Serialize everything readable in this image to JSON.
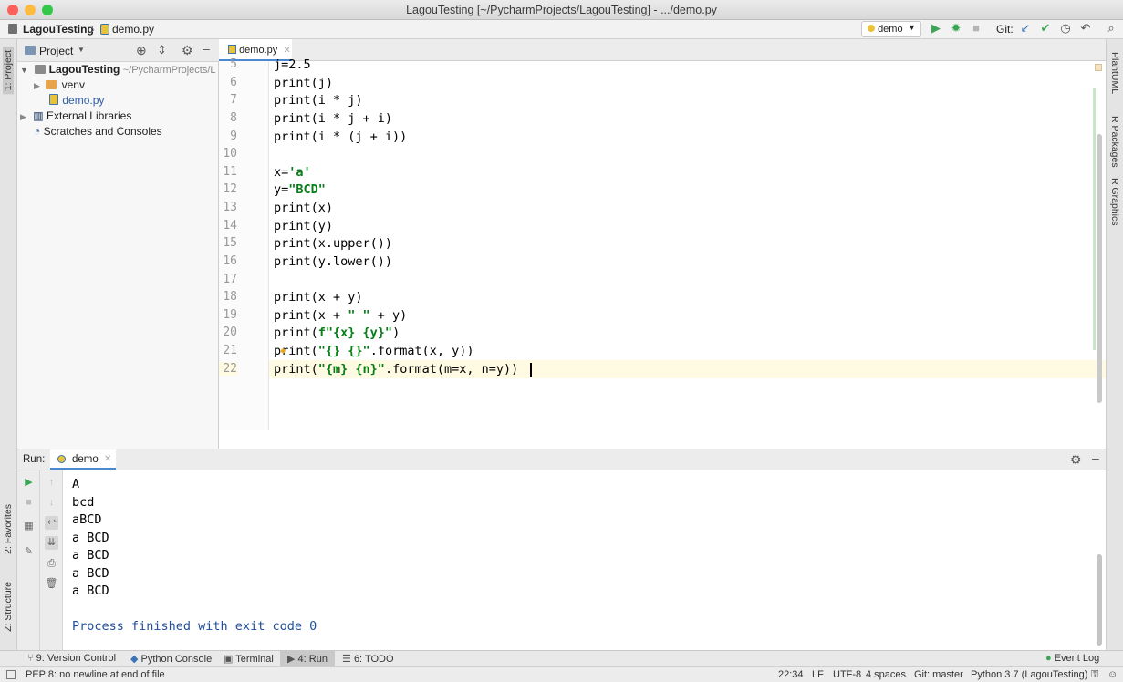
{
  "window": {
    "title": "LagouTesting [~/PycharmProjects/LagouTesting] - .../demo.py"
  },
  "navbar": {
    "project": "LagouTesting",
    "file": "demo.py",
    "run_config": "demo",
    "git_label": "Git:"
  },
  "project_panel": {
    "title": "Project",
    "root": {
      "name": "LagouTesting",
      "path": "~/PycharmProjects/L"
    },
    "items": [
      {
        "label": "venv",
        "icon": "folder-icon"
      },
      {
        "label": "demo.py",
        "icon": "python-file-icon"
      },
      {
        "label": "External Libraries",
        "icon": "library-icon"
      },
      {
        "label": "Scratches and Consoles",
        "icon": "scratch-icon"
      }
    ]
  },
  "left_tool_tabs": [
    "1: Project",
    "2: Favorites",
    "Z: Structure"
  ],
  "right_tool_tabs": [
    "PlantUML",
    "R Packages",
    "R Graphics"
  ],
  "editor": {
    "tab": "demo.py",
    "lines": [
      {
        "n": "5",
        "text": "j=2.5"
      },
      {
        "n": "6",
        "text": "print(j)"
      },
      {
        "n": "7",
        "text": "print(i * j)"
      },
      {
        "n": "8",
        "text": "print(i * j + i)"
      },
      {
        "n": "9",
        "text": "print(i * (j + i))"
      },
      {
        "n": "10",
        "text": ""
      },
      {
        "n": "11",
        "text": "x='a'"
      },
      {
        "n": "12",
        "text": "y=\"BCD\""
      },
      {
        "n": "13",
        "text": "print(x)"
      },
      {
        "n": "14",
        "text": "print(y)"
      },
      {
        "n": "15",
        "text": "print(x.upper())"
      },
      {
        "n": "16",
        "text": "print(y.lower())"
      },
      {
        "n": "17",
        "text": ""
      },
      {
        "n": "18",
        "text": "print(x + y)"
      },
      {
        "n": "19",
        "text": "print(x + \" \" + y)"
      },
      {
        "n": "20",
        "text": "print(f\"{x} {y}\")"
      },
      {
        "n": "21",
        "text": "print(\"{} {}\".format(x, y))"
      },
      {
        "n": "22",
        "text": "print(\"{m} {n}\".format(m=x, n=y))"
      }
    ]
  },
  "run_panel": {
    "label": "Run:",
    "tab": "demo",
    "output": [
      "A",
      "bcd",
      "aBCD",
      "a BCD",
      "a BCD",
      "a BCD",
      "a BCD",
      "",
      "Process finished with exit code 0"
    ]
  },
  "bottom_tabs": [
    "9: Version Control",
    "Python Console",
    "Terminal",
    "4: Run",
    "6: TODO",
    "Event Log"
  ],
  "status": {
    "message": "PEP 8: no newline at end of file",
    "position": "22:34",
    "line_sep": "LF",
    "encoding": "UTF-8",
    "indent": "4 spaces",
    "git": "Git: master",
    "interpreter": "Python 3.7 (LagouTesting)"
  },
  "colors": {
    "accent": "#4a88d6",
    "traffic_red": "#fc605c",
    "traffic_yellow": "#fdbc40",
    "traffic_green": "#34c84a",
    "run_green": "#3aa655"
  }
}
